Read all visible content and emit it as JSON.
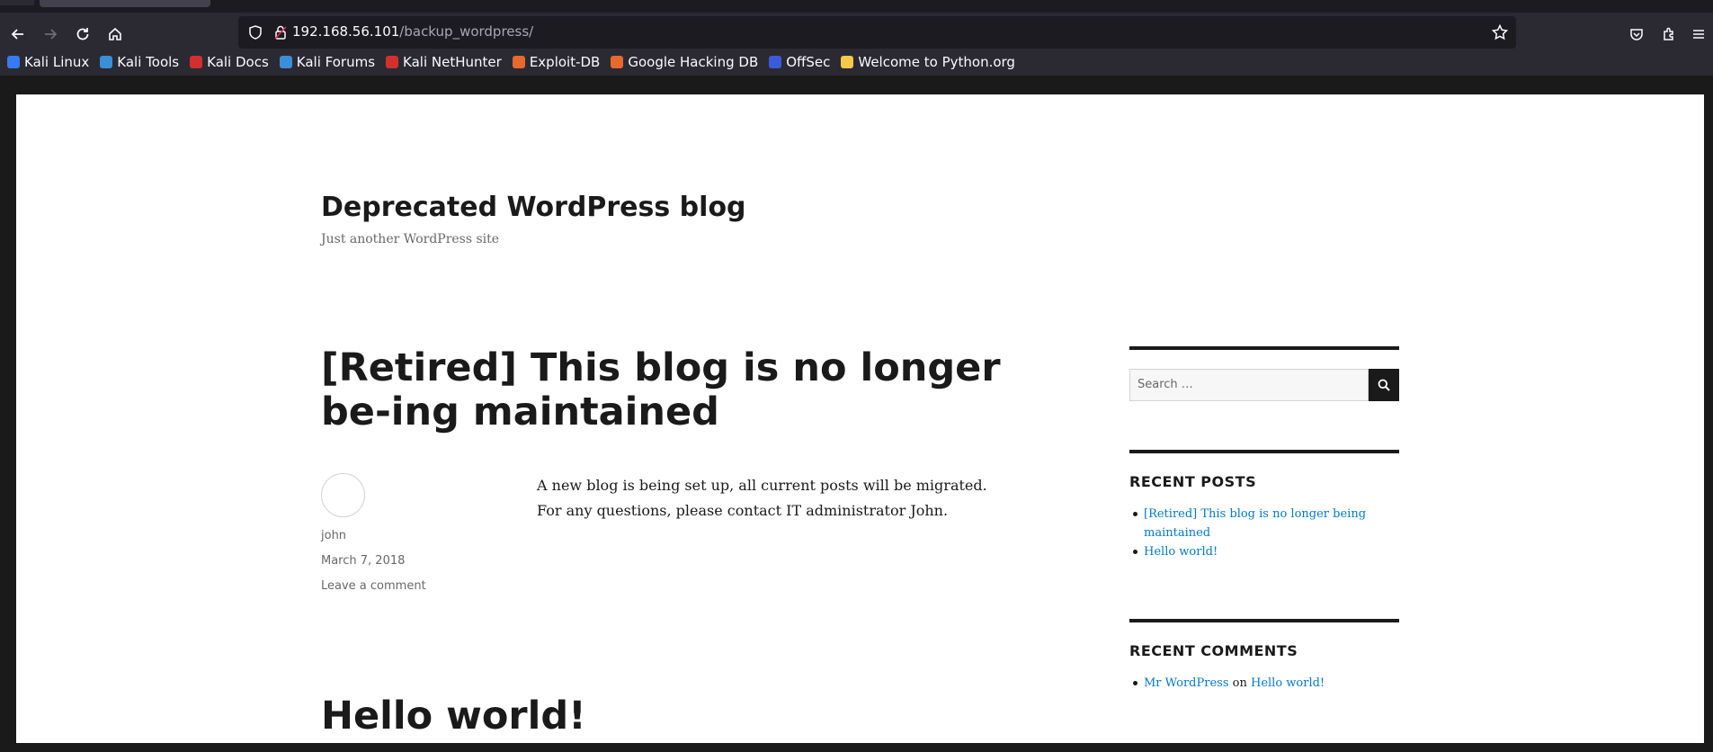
{
  "browser": {
    "url_host": "192.168.56.101",
    "url_path": "/backup_wordpress/",
    "bookmarks": [
      {
        "label": "Kali Linux",
        "color": "#367bf0"
      },
      {
        "label": "Kali Tools",
        "color": "#3a8fd8"
      },
      {
        "label": "Kali Docs",
        "color": "#d32f2f"
      },
      {
        "label": "Kali Forums",
        "color": "#3a8fd8"
      },
      {
        "label": "Kali NetHunter",
        "color": "#d32f2f"
      },
      {
        "label": "Exploit-DB",
        "color": "#e8692c"
      },
      {
        "label": "Google Hacking DB",
        "color": "#e8692c"
      },
      {
        "label": "OffSec",
        "color": "#3b5bdb"
      },
      {
        "label": "Welcome to Python.org",
        "color": "#f7c948"
      }
    ]
  },
  "site": {
    "title": "Deprecated WordPress blog",
    "description": "Just another WordPress site"
  },
  "post": {
    "title": "[Retired] This blog is no longer be-ing maintained",
    "author": "john",
    "date": "March 7, 2018",
    "comment_link": "Leave a comment",
    "body_line1": "A new blog is being set up, all current posts will be migrated.",
    "body_line2": "For any questions, please contact IT administrator John."
  },
  "post2": {
    "title": "Hello world!"
  },
  "sidebar": {
    "search_placeholder": "Search …",
    "recent_posts_title": "RECENT POSTS",
    "recent_posts": [
      "[Retired] This blog is no longer being maintained",
      "Hello world!"
    ],
    "recent_comments_title": "RECENT COMMENTS",
    "recent_comment": {
      "author": "Mr WordPress",
      "on": "on",
      "post": "Hello world!"
    }
  }
}
